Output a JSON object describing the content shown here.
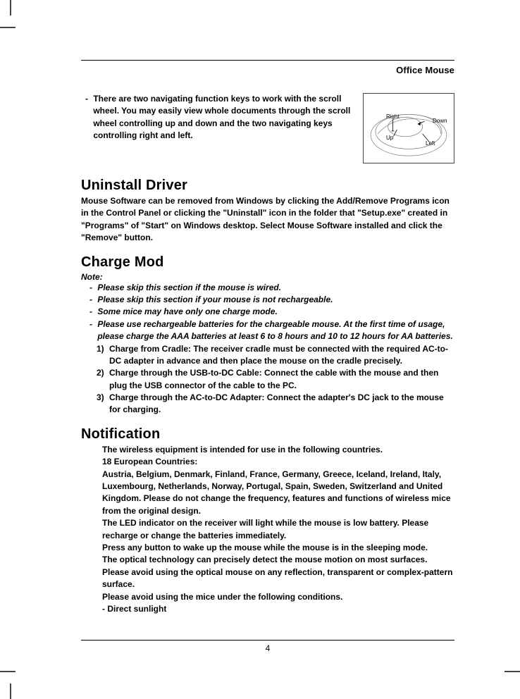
{
  "header": {
    "title": "Office Mouse"
  },
  "intro": {
    "bullet": "- ",
    "text": "There are two navigating function keys to work with the scroll wheel.  You may easily view whole documents through the scroll wheel controlling up and down and the two navigating keys controlling right and left.",
    "diagram": {
      "right": "Right",
      "down": "Down",
      "up": "Up",
      "left": "Left"
    }
  },
  "uninstall": {
    "heading": "Uninstall Driver",
    "body": "Mouse Software can be removed from Windows by clicking the Add/Remove Programs icon in the Control Panel or clicking the \"Uninstall\" icon in the folder that \"Setup.exe\" created in \"Programs\" of \"Start\" on Windows desktop.  Select Mouse Software installed and click the \"Remove\" button."
  },
  "charge": {
    "heading": "Charge Mod",
    "note_label": "Note:",
    "notes": [
      "Please skip this section if the mouse is wired.",
      "Please skip this section if your mouse is not rechargeable.",
      "Some mice may have only one charge mode.",
      "Please use rechargeable batteries for the chargeable mouse.  At the first time of usage, please charge the AAA batteries at least 6 to 8 hours and 10 to 12 hours for AA batteries."
    ],
    "steps": [
      "Charge from Cradle: The receiver cradle must be connected with the required AC-to-DC adapter in advance and then place the mouse on the cradle precisely.",
      "Charge through the USB-to-DC Cable: Connect the cable with the mouse and then plug the USB connector of the cable to the PC.",
      "Charge through the AC-to-DC Adapter: Connect the adapter's DC jack to the mouse for charging."
    ]
  },
  "notification": {
    "heading": "Notification",
    "p1": "The wireless equipment is intended for use in the following countries.",
    "p2": "18 European Countries:",
    "p3": "Austria, Belgium, Denmark, Finland, France, Germany, Greece, Iceland, Ireland, Italy, Luxembourg, Netherlands, Norway, Portugal, Spain, Sweden, Switzerland and United Kingdom. Please do not change the frequency, features and functions of wireless mice from the original design.",
    "p4": "The LED indicator on the receiver will light while the mouse is low battery.  Please recharge or change the batteries immediately.",
    "p5": "Press any button to wake up the mouse while the mouse is in the sleeping mode.",
    "p6": "The optical technology can precisely detect the mouse motion on most surfaces.  Please avoid using the optical mouse on any reflection, transparent or complex-pattern surface.",
    "p7": "Please avoid using the mice under the following conditions.",
    "p8": "- Direct sunlight"
  },
  "footer": {
    "page": "4"
  }
}
